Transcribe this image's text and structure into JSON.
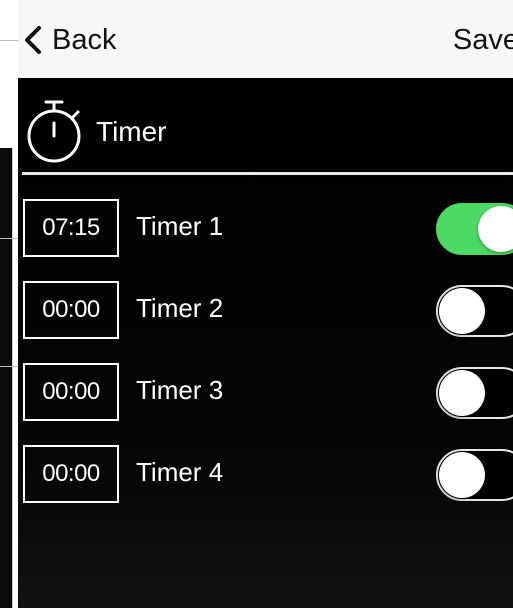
{
  "nav": {
    "back_label": "Back",
    "save_label": "Save"
  },
  "header": {
    "title": "Timer",
    "icon": "stopwatch-icon"
  },
  "timers": [
    {
      "time": "07:15",
      "label": "Timer 1",
      "enabled": true
    },
    {
      "time": "00:00",
      "label": "Timer 2",
      "enabled": false
    },
    {
      "time": "00:00",
      "label": "Timer 3",
      "enabled": false
    },
    {
      "time": "00:00",
      "label": "Timer 4",
      "enabled": false
    }
  ],
  "colors": {
    "toggle_on": "#4cd964",
    "background": "#000000",
    "navbar": "#f7f7f7"
  }
}
